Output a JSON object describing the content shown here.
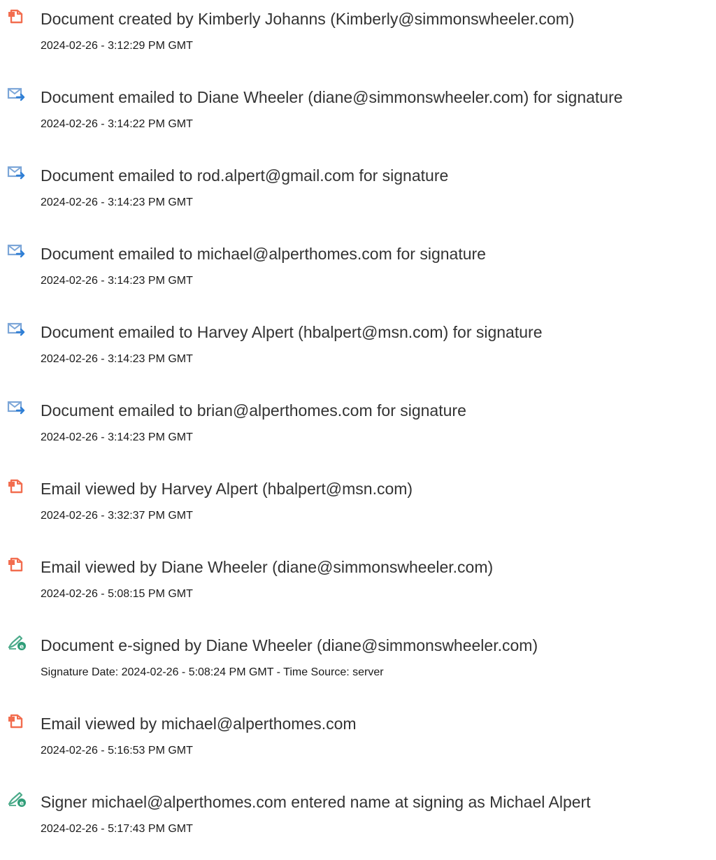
{
  "colors": {
    "document_icon": "#f26d4f",
    "email_icon": "#7ca6d8",
    "email_arrow": "#2f7fd6",
    "sign_pen": "#4dab8b",
    "sign_badge": "#2f9d78"
  },
  "events": [
    {
      "icon": "document-icon",
      "text": "Document created by Kimberly Johanns (Kimberly@simmonswheeler.com)",
      "time": "2024-02-26 - 3:12:29 PM GMT"
    },
    {
      "icon": "email-sent-icon",
      "text": "Document emailed to Diane Wheeler (diane@simmonswheeler.com) for signature",
      "time": "2024-02-26 - 3:14:22 PM GMT"
    },
    {
      "icon": "email-sent-icon",
      "text": "Document emailed to rod.alpert@gmail.com for signature",
      "time": "2024-02-26 - 3:14:23 PM GMT"
    },
    {
      "icon": "email-sent-icon",
      "text": "Document emailed to michael@alperthomes.com for signature",
      "time": "2024-02-26 - 3:14:23 PM GMT"
    },
    {
      "icon": "email-sent-icon",
      "text": "Document emailed to Harvey Alpert (hbalpert@msn.com) for signature",
      "time": "2024-02-26 - 3:14:23 PM GMT"
    },
    {
      "icon": "email-sent-icon",
      "text": "Document emailed to brian@alperthomes.com for signature",
      "time": "2024-02-26 - 3:14:23 PM GMT"
    },
    {
      "icon": "document-icon",
      "text": "Email viewed by Harvey Alpert (hbalpert@msn.com)",
      "time": "2024-02-26 - 3:32:37 PM GMT"
    },
    {
      "icon": "document-icon",
      "text": "Email viewed by Diane Wheeler (diane@simmonswheeler.com)",
      "time": "2024-02-26 - 5:08:15 PM GMT"
    },
    {
      "icon": "esign-icon",
      "text": "Document e-signed by Diane Wheeler (diane@simmonswheeler.com)",
      "time": "Signature Date: 2024-02-26 - 5:08:24 PM GMT - Time Source: server"
    },
    {
      "icon": "document-icon",
      "text": "Email viewed by michael@alperthomes.com",
      "time": "2024-02-26 - 5:16:53 PM GMT"
    },
    {
      "icon": "esign-icon",
      "text": "Signer michael@alperthomes.com entered name at signing as Michael Alpert",
      "time": "2024-02-26 - 5:17:43 PM GMT"
    }
  ]
}
